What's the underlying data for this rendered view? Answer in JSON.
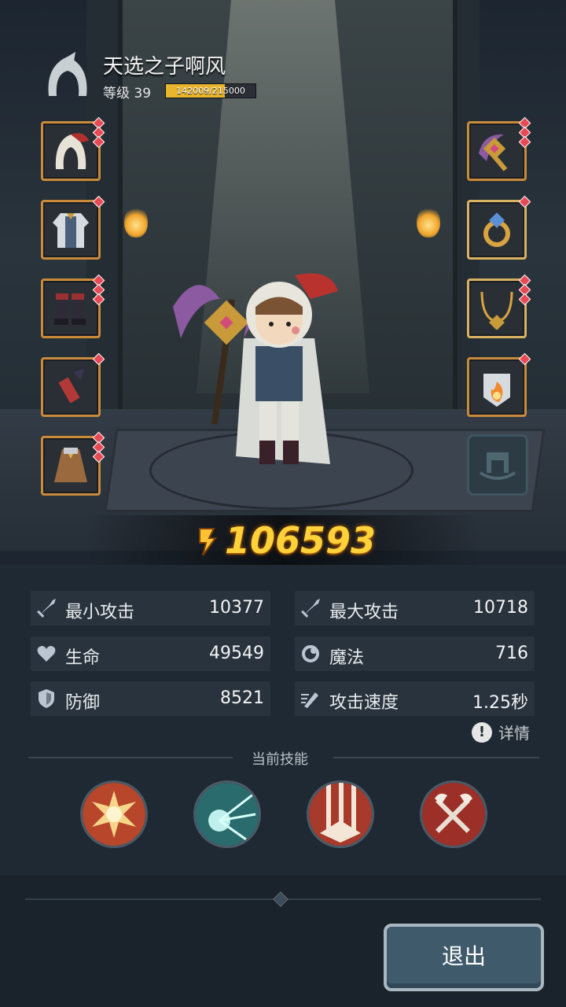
{
  "player": {
    "name": "天选之子啊风",
    "level_label": "等级 39",
    "xp_text": "142009/215000",
    "xp_fraction": 0.66
  },
  "power": {
    "value": "106593"
  },
  "stats": [
    {
      "label": "最小攻击",
      "value": "10377",
      "icon": "sword-icon"
    },
    {
      "label": "最大攻击",
      "value": "10718",
      "icon": "sword-icon"
    },
    {
      "label": "生命",
      "value": "49549",
      "icon": "heart-icon"
    },
    {
      "label": "魔法",
      "value": "716",
      "icon": "magic-icon"
    },
    {
      "label": "防御",
      "value": "8521",
      "icon": "shield-icon"
    },
    {
      "label": "攻击速度",
      "value": "1.25秒",
      "icon": "speed-icon"
    }
  ],
  "detail_label": "详情",
  "skills_title": "当前技能",
  "skills": [
    {
      "icon": "explosion-skill-icon"
    },
    {
      "icon": "frost-orb-skill-icon"
    },
    {
      "icon": "holy-light-skill-icon"
    },
    {
      "icon": "dual-axe-skill-icon"
    }
  ],
  "equipment_left": [
    "hood-icon",
    "robe-icon",
    "boots-icon",
    "bracer-icon",
    "cloak-icon"
  ],
  "equipment_right": [
    "staff-icon",
    "ring-icon",
    "necklace-icon",
    "fire-charm-icon"
  ],
  "exit_label": "退出",
  "colors": {
    "power": "#ffd23a",
    "slot_border": "#c98a3a",
    "gem": "#e74a55",
    "xp_fill": "#e8b52c"
  }
}
